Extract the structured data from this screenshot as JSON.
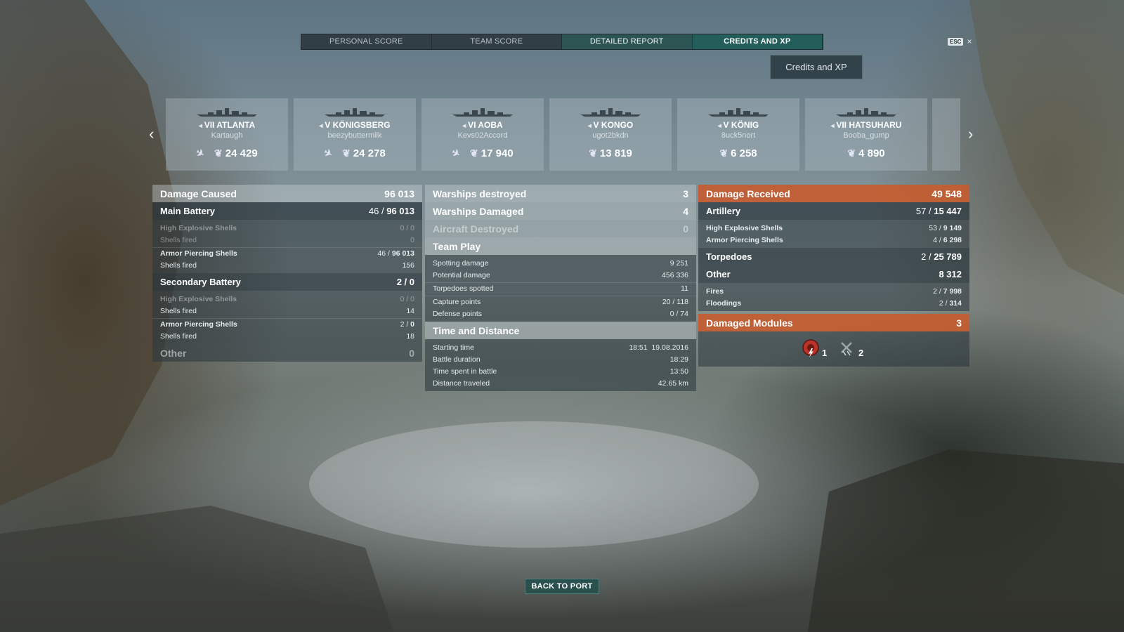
{
  "tabs": [
    {
      "label": "PERSONAL SCORE"
    },
    {
      "label": "TEAM SCORE"
    },
    {
      "label": "DETAILED REPORT"
    },
    {
      "label": "CREDITS AND XP"
    }
  ],
  "esc": {
    "key": "ESC",
    "close": "×"
  },
  "tooltip": "Credits and XP",
  "ships": [
    {
      "tier": "VII",
      "name": "ATLANTA",
      "player": "Kartaugh",
      "score": "24 429",
      "plane": true
    },
    {
      "tier": "V",
      "name": "KÖNIGSBERG",
      "player": "beezybuttermilk",
      "score": "24 278",
      "plane": true
    },
    {
      "tier": "VI",
      "name": "AOBA",
      "player": "Kevs02Accord",
      "score": "17 940",
      "plane": true
    },
    {
      "tier": "V",
      "name": "KONGO",
      "player": "ugot2bkdn",
      "score": "13 819",
      "plane": false
    },
    {
      "tier": "V",
      "name": "KÖNIG",
      "player": "8uck5nort",
      "score": "6 258",
      "plane": false
    },
    {
      "tier": "VII",
      "name": "HATSUHARU",
      "player": "Booba_gump",
      "score": "4 890",
      "plane": false
    }
  ],
  "damage_caused": {
    "title": "Damage Caused",
    "value": "96 013",
    "main_battery": {
      "title": "Main Battery",
      "hits": "46",
      "dmg": "96 013"
    },
    "mb_he": {
      "label": "High Explosive Shells",
      "value": "0 / 0"
    },
    "mb_he_fired": {
      "label": "Shells fired",
      "value": "0"
    },
    "mb_ap": {
      "label": "Armor Piercing Shells",
      "hits": "46 / ",
      "dmg": "96 013"
    },
    "mb_ap_fired": {
      "label": "Shells fired",
      "value": "156"
    },
    "secondary": {
      "title": "Secondary Battery",
      "value": "2 / 0"
    },
    "sb_he": {
      "label": "High Explosive Shells",
      "value": "0 / 0"
    },
    "sb_he_fired": {
      "label": "Shells fired",
      "value": "14"
    },
    "sb_ap": {
      "label": "Armor Piercing Shells",
      "hits": "2 / ",
      "dmg": "0"
    },
    "sb_ap_fired": {
      "label": "Shells fired",
      "value": "18"
    },
    "other": {
      "title": "Other",
      "value": "0"
    }
  },
  "middle": {
    "warships_destroyed": {
      "label": "Warships destroyed",
      "value": "3"
    },
    "warships_damaged": {
      "label": "Warships Damaged",
      "value": "4"
    },
    "aircraft_destroyed": {
      "label": "Aircraft Destroyed",
      "value": "0"
    },
    "team_play": {
      "title": "Team Play"
    },
    "spotting": {
      "label": "Spotting damage",
      "value": "9 251"
    },
    "potential": {
      "label": "Potential damage",
      "value": "456 336"
    },
    "torp_spotted": {
      "label": "Torpedoes spotted",
      "value": "11"
    },
    "capture": {
      "label": "Capture points",
      "value": "20 / 118"
    },
    "defense": {
      "label": "Defense points",
      "value": "0 / 74"
    },
    "time_distance": {
      "title": "Time and Distance"
    },
    "start": {
      "label": "Starting time",
      "value": "18:51  19.08.2016"
    },
    "duration": {
      "label": "Battle duration",
      "value": "18:29"
    },
    "spent": {
      "label": "Time spent in battle",
      "value": "13:50"
    },
    "distance": {
      "label": "Distance traveled",
      "value": "42.65 km"
    }
  },
  "damage_received": {
    "title": "Damage Received",
    "value": "49 548",
    "artillery": {
      "title": "Artillery",
      "hits": "57",
      "dmg": "15 447"
    },
    "he": {
      "label": "High Explosive Shells",
      "hits": "53 / ",
      "dmg": "9 149"
    },
    "ap": {
      "label": "Armor Piercing Shells",
      "hits": "4 / ",
      "dmg": "6 298"
    },
    "torpedoes": {
      "title": "Torpedoes",
      "hits": "2",
      "dmg": "25 789"
    },
    "other": {
      "title": "Other",
      "value": "8 312"
    },
    "fires": {
      "label": "Fires",
      "hits": "2 / ",
      "dmg": "7 998"
    },
    "floodings": {
      "label": "Floodings",
      "hits": "2 / ",
      "dmg": "314"
    },
    "modules": {
      "title": "Damaged Modules",
      "value": "3",
      "engine_count": "1",
      "steering_count": "2"
    }
  },
  "back_button": "BACK TO PORT",
  "colors": {
    "accent_teal": "#24605c",
    "damage_orange": "#c45c30"
  }
}
